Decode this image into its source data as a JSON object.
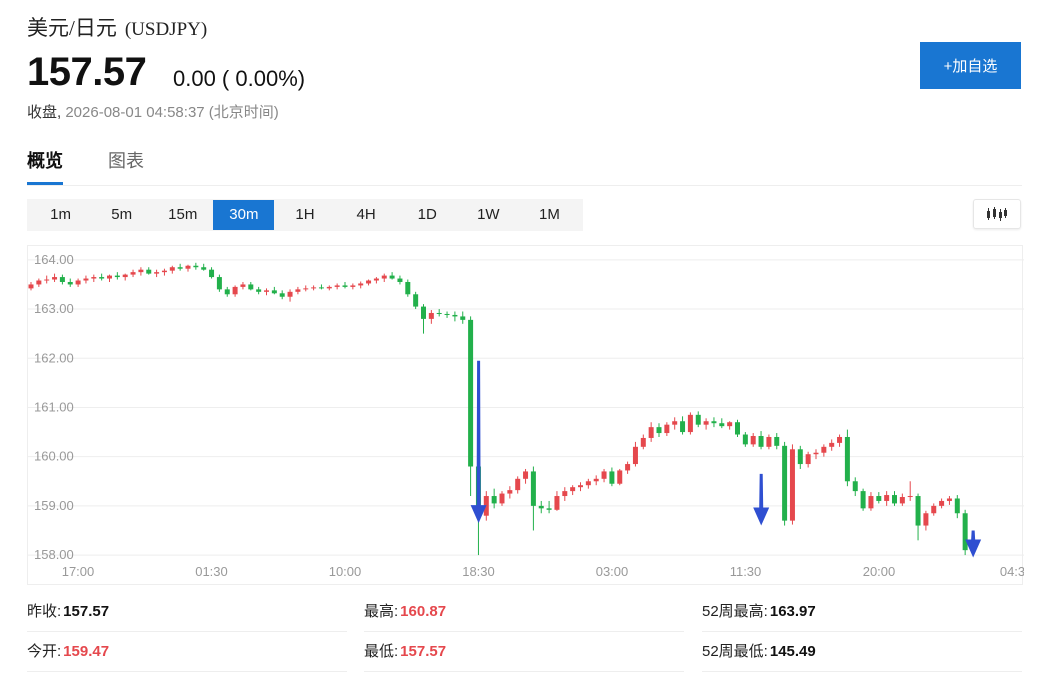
{
  "header": {
    "name": "美元/日元",
    "symbol": "(USDJPY)",
    "price": "157.57",
    "change": "0.00 ( 0.00%)",
    "status_label": "收盘,",
    "timestamp": "2026-08-01 04:58:37 (北京时间)"
  },
  "actions": {
    "add_watchlist": "+加自选"
  },
  "tabs": [
    {
      "label": "概览",
      "active": true
    },
    {
      "label": "图表",
      "active": false
    }
  ],
  "intervals": [
    "1m",
    "5m",
    "15m",
    "30m",
    "1H",
    "4H",
    "1D",
    "1W",
    "1M"
  ],
  "active_interval": "30m",
  "colors": {
    "up": "#e5484d",
    "down": "#22b04b",
    "accent": "#1976d2",
    "arrow": "#2f4fd1"
  },
  "chart_data": {
    "type": "candlestick",
    "ylim": [
      157.9,
      164.2
    ],
    "y_ticks": [
      "164.00",
      "163.00",
      "162.00",
      "161.00",
      "160.00",
      "159.00",
      "158.00"
    ],
    "x_ticks": [
      "17:00",
      "01:30",
      "10:00",
      "18:30",
      "03:00",
      "11:30",
      "20:00",
      "04:3"
    ],
    "candles_per_tick": 17,
    "candles": [
      [
        163.42,
        163.55,
        163.38,
        163.5
      ],
      [
        163.5,
        163.62,
        163.45,
        163.58
      ],
      [
        163.58,
        163.68,
        163.52,
        163.6
      ],
      [
        163.6,
        163.72,
        163.55,
        163.65
      ],
      [
        163.65,
        163.7,
        163.5,
        163.55
      ],
      [
        163.55,
        163.62,
        163.45,
        163.5
      ],
      [
        163.5,
        163.62,
        163.45,
        163.58
      ],
      [
        163.58,
        163.68,
        163.52,
        163.62
      ],
      [
        163.62,
        163.7,
        163.55,
        163.65
      ],
      [
        163.65,
        163.72,
        163.58,
        163.62
      ],
      [
        163.62,
        163.7,
        163.55,
        163.68
      ],
      [
        163.68,
        163.75,
        163.6,
        163.65
      ],
      [
        163.65,
        163.72,
        163.58,
        163.7
      ],
      [
        163.7,
        163.8,
        163.65,
        163.75
      ],
      [
        163.75,
        163.85,
        163.68,
        163.8
      ],
      [
        163.8,
        163.85,
        163.7,
        163.72
      ],
      [
        163.72,
        163.8,
        163.65,
        163.75
      ],
      [
        163.75,
        163.82,
        163.68,
        163.78
      ],
      [
        163.78,
        163.88,
        163.72,
        163.85
      ],
      [
        163.85,
        163.92,
        163.78,
        163.82
      ],
      [
        163.82,
        163.9,
        163.76,
        163.88
      ],
      [
        163.88,
        163.94,
        163.8,
        163.85
      ],
      [
        163.85,
        163.92,
        163.78,
        163.8
      ],
      [
        163.8,
        163.85,
        163.62,
        163.65
      ],
      [
        163.65,
        163.7,
        163.35,
        163.4
      ],
      [
        163.4,
        163.45,
        163.25,
        163.3
      ],
      [
        163.3,
        163.48,
        163.25,
        163.45
      ],
      [
        163.45,
        163.55,
        163.4,
        163.5
      ],
      [
        163.5,
        163.55,
        163.38,
        163.4
      ],
      [
        163.4,
        163.45,
        163.3,
        163.35
      ],
      [
        163.35,
        163.42,
        163.28,
        163.38
      ],
      [
        163.38,
        163.45,
        163.3,
        163.32
      ],
      [
        163.32,
        163.38,
        163.2,
        163.25
      ],
      [
        163.25,
        163.4,
        163.15,
        163.35
      ],
      [
        163.35,
        163.45,
        163.3,
        163.4
      ],
      [
        163.4,
        163.48,
        163.36,
        163.42
      ],
      [
        163.42,
        163.48,
        163.38,
        163.44
      ],
      [
        163.44,
        163.5,
        163.4,
        163.42
      ],
      [
        163.42,
        163.48,
        163.38,
        163.45
      ],
      [
        163.45,
        163.52,
        163.4,
        163.48
      ],
      [
        163.48,
        163.55,
        163.42,
        163.45
      ],
      [
        163.45,
        163.52,
        163.4,
        163.48
      ],
      [
        163.48,
        163.56,
        163.42,
        163.52
      ],
      [
        163.52,
        163.6,
        163.48,
        163.58
      ],
      [
        163.58,
        163.65,
        163.52,
        163.62
      ],
      [
        163.62,
        163.72,
        163.55,
        163.68
      ],
      [
        163.68,
        163.75,
        163.6,
        163.62
      ],
      [
        163.62,
        163.68,
        163.5,
        163.55
      ],
      [
        163.55,
        163.6,
        163.25,
        163.3
      ],
      [
        163.3,
        163.35,
        163.0,
        163.05
      ],
      [
        163.05,
        163.1,
        162.5,
        162.8
      ],
      [
        162.8,
        162.98,
        162.7,
        162.92
      ],
      [
        162.92,
        163.0,
        162.85,
        162.9
      ],
      [
        162.9,
        162.95,
        162.82,
        162.88
      ],
      [
        162.88,
        162.95,
        162.75,
        162.85
      ],
      [
        162.85,
        162.95,
        162.7,
        162.78
      ],
      [
        162.78,
        162.85,
        159.2,
        159.8
      ],
      [
        159.8,
        159.85,
        158.0,
        158.8
      ],
      [
        158.8,
        159.3,
        158.7,
        159.2
      ],
      [
        159.2,
        159.35,
        158.95,
        159.05
      ],
      [
        159.05,
        159.3,
        159.0,
        159.25
      ],
      [
        159.25,
        159.4,
        159.15,
        159.32
      ],
      [
        159.32,
        159.6,
        159.25,
        159.55
      ],
      [
        159.55,
        159.75,
        159.45,
        159.7
      ],
      [
        159.7,
        159.8,
        158.5,
        159.0
      ],
      [
        159.0,
        159.1,
        158.85,
        158.95
      ],
      [
        158.95,
        159.1,
        158.85,
        158.92
      ],
      [
        158.92,
        159.3,
        158.9,
        159.2
      ],
      [
        159.2,
        159.38,
        159.1,
        159.3
      ],
      [
        159.3,
        159.42,
        159.22,
        159.38
      ],
      [
        159.38,
        159.48,
        159.3,
        159.42
      ],
      [
        159.42,
        159.55,
        159.35,
        159.5
      ],
      [
        159.5,
        159.62,
        159.42,
        159.55
      ],
      [
        159.55,
        159.75,
        159.48,
        159.7
      ],
      [
        159.7,
        159.78,
        159.4,
        159.45
      ],
      [
        159.45,
        159.75,
        159.42,
        159.72
      ],
      [
        159.72,
        159.9,
        159.65,
        159.85
      ],
      [
        159.85,
        160.3,
        159.8,
        160.2
      ],
      [
        160.2,
        160.45,
        160.15,
        160.38
      ],
      [
        160.38,
        160.7,
        160.3,
        160.6
      ],
      [
        160.6,
        160.68,
        160.4,
        160.48
      ],
      [
        160.48,
        160.7,
        160.42,
        160.65
      ],
      [
        160.65,
        160.8,
        160.55,
        160.72
      ],
      [
        160.72,
        160.82,
        160.45,
        160.5
      ],
      [
        160.5,
        160.9,
        160.45,
        160.85
      ],
      [
        160.85,
        160.92,
        160.6,
        160.65
      ],
      [
        160.65,
        160.78,
        160.55,
        160.72
      ],
      [
        160.72,
        160.8,
        160.6,
        160.68
      ],
      [
        160.68,
        160.78,
        160.58,
        160.62
      ],
      [
        160.62,
        160.72,
        160.55,
        160.7
      ],
      [
        160.7,
        160.75,
        160.4,
        160.45
      ],
      [
        160.45,
        160.5,
        160.2,
        160.25
      ],
      [
        160.25,
        160.48,
        160.2,
        160.42
      ],
      [
        160.42,
        160.52,
        160.15,
        160.2
      ],
      [
        160.2,
        160.45,
        160.15,
        160.4
      ],
      [
        160.4,
        160.48,
        160.15,
        160.22
      ],
      [
        160.22,
        160.3,
        158.6,
        158.7
      ],
      [
        158.7,
        160.25,
        158.62,
        160.15
      ],
      [
        160.15,
        160.22,
        159.75,
        159.85
      ],
      [
        159.85,
        160.1,
        159.78,
        160.05
      ],
      [
        160.05,
        160.15,
        159.95,
        160.08
      ],
      [
        160.08,
        160.25,
        160.0,
        160.2
      ],
      [
        160.2,
        160.35,
        160.12,
        160.28
      ],
      [
        160.28,
        160.45,
        160.2,
        160.4
      ],
      [
        160.4,
        160.55,
        159.4,
        159.5
      ],
      [
        159.5,
        159.58,
        159.2,
        159.3
      ],
      [
        159.3,
        159.35,
        158.9,
        158.95
      ],
      [
        158.95,
        159.28,
        158.9,
        159.2
      ],
      [
        159.2,
        159.28,
        159.05,
        159.1
      ],
      [
        159.1,
        159.3,
        159.0,
        159.22
      ],
      [
        159.22,
        159.3,
        159.0,
        159.05
      ],
      [
        159.05,
        159.25,
        159.0,
        159.18
      ],
      [
        159.18,
        159.5,
        159.1,
        159.2
      ],
      [
        159.2,
        159.25,
        158.3,
        158.6
      ],
      [
        158.6,
        158.9,
        158.5,
        158.85
      ],
      [
        158.85,
        159.05,
        158.8,
        159.0
      ],
      [
        159.0,
        159.15,
        158.95,
        159.1
      ],
      [
        159.1,
        159.2,
        159.02,
        159.15
      ],
      [
        159.15,
        159.22,
        158.75,
        158.85
      ],
      [
        158.85,
        158.92,
        158.0,
        158.1
      ]
    ],
    "annotations": [
      {
        "type": "arrow-down",
        "x_index": 56,
        "from": 161.95,
        "to": 158.65
      },
      {
        "type": "arrow-down",
        "x_index": 92,
        "from": 159.65,
        "to": 158.6
      },
      {
        "type": "arrow-down",
        "x_index": 119,
        "from": 158.5,
        "to": 157.95
      }
    ]
  },
  "stats": [
    {
      "label": "昨收:",
      "value": "157.57",
      "tone": "black"
    },
    {
      "label": "最高:",
      "value": "160.87",
      "tone": "red"
    },
    {
      "label": "52周最高:",
      "value": "163.97",
      "tone": "black"
    },
    {
      "label": "今开:",
      "value": "159.47",
      "tone": "red"
    },
    {
      "label": "最低:",
      "value": "157.57",
      "tone": "red"
    },
    {
      "label": "52周最低:",
      "value": "145.49",
      "tone": "black"
    }
  ]
}
